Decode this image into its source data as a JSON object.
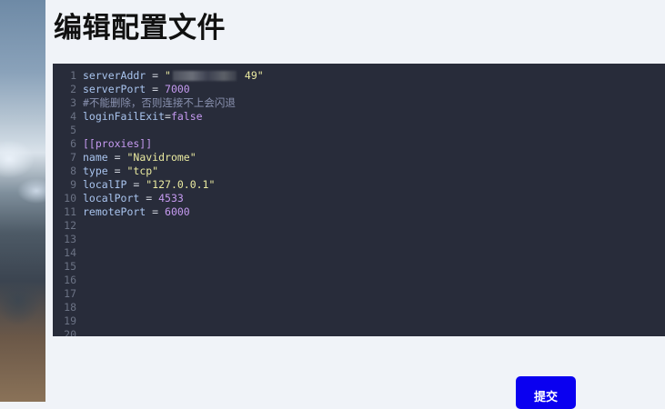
{
  "page": {
    "title": "编辑配置文件"
  },
  "editor": {
    "lines": [
      {
        "n": "1",
        "parts": [
          [
            "key",
            "serverAddr"
          ],
          [
            "op",
            " = "
          ],
          [
            "str",
            "\""
          ],
          [
            "blur",
            ""
          ],
          [
            "str",
            " 49\""
          ]
        ]
      },
      {
        "n": "2",
        "parts": [
          [
            "key",
            "serverPort"
          ],
          [
            "op",
            " = "
          ],
          [
            "num",
            "7000"
          ]
        ]
      },
      {
        "n": "3",
        "parts": [
          [
            "cmt",
            "#不能删除，否则连接不上会闪退"
          ]
        ]
      },
      {
        "n": "4",
        "parts": [
          [
            "key",
            "loginFailExit"
          ],
          [
            "op",
            "="
          ],
          [
            "bool",
            "false"
          ]
        ]
      },
      {
        "n": "5",
        "parts": []
      },
      {
        "n": "6",
        "parts": [
          [
            "sec",
            "[[proxies]]"
          ]
        ]
      },
      {
        "n": "7",
        "parts": [
          [
            "key",
            "name"
          ],
          [
            "op",
            " = "
          ],
          [
            "str",
            "\"Navidrome\""
          ]
        ]
      },
      {
        "n": "8",
        "parts": [
          [
            "key",
            "type"
          ],
          [
            "op",
            " = "
          ],
          [
            "str",
            "\"tcp\""
          ]
        ]
      },
      {
        "n": "9",
        "parts": [
          [
            "key",
            "localIP"
          ],
          [
            "op",
            " = "
          ],
          [
            "str",
            "\"127.0.0.1\""
          ]
        ]
      },
      {
        "n": "10",
        "parts": [
          [
            "key",
            "localPort"
          ],
          [
            "op",
            " = "
          ],
          [
            "num",
            "4533"
          ]
        ]
      },
      {
        "n": "11",
        "parts": [
          [
            "key",
            "remotePort"
          ],
          [
            "op",
            " = "
          ],
          [
            "num",
            "6000"
          ]
        ]
      },
      {
        "n": "12",
        "parts": []
      },
      {
        "n": "13",
        "parts": []
      },
      {
        "n": "14",
        "parts": []
      },
      {
        "n": "15",
        "parts": []
      },
      {
        "n": "16",
        "parts": []
      },
      {
        "n": "17",
        "parts": []
      },
      {
        "n": "18",
        "parts": []
      },
      {
        "n": "19",
        "parts": []
      },
      {
        "n": "20",
        "parts": []
      }
    ]
  },
  "actions": {
    "submit_label": "提交"
  },
  "colors": {
    "editor_bg": "#282c3a",
    "submit_bg": "#0a00f0"
  }
}
